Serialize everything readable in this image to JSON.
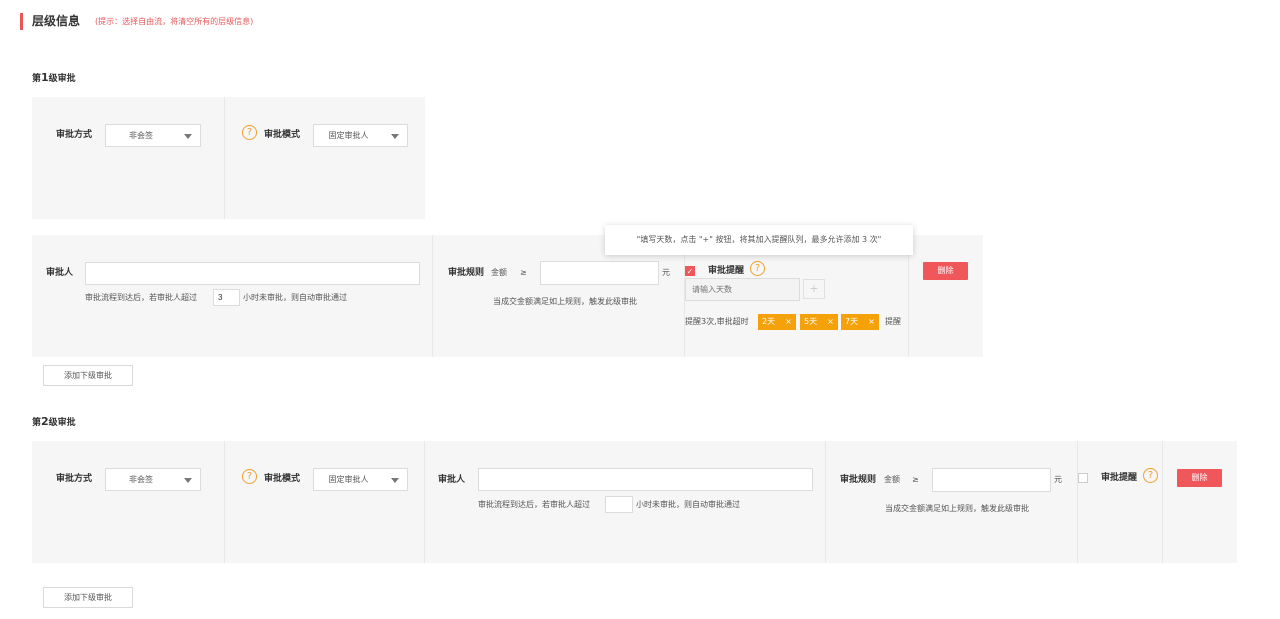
{
  "section": {
    "title": "层级信息",
    "hint": "(提示：选择自由流，将清空所有的层级信息)"
  },
  "level1": {
    "title_prefix": "第",
    "title_num": "1",
    "title_suffix": "级审批",
    "method_label": "审批方式",
    "method_value": "非会签",
    "mode_label": "审批模式",
    "mode_value": "固定审批人",
    "approver_label": "审批人",
    "approver_value": "",
    "timeout_prefix": "审批流程到达后，若审批人超过",
    "timeout_hours": "3",
    "timeout_suffix": "小时未审批，则自动审批通过",
    "rule_label": "审批规则",
    "amount_label": "金额",
    "gte": "≥",
    "amount_value": "",
    "unit": "元",
    "rule_desc": "当成交金额满足如上规则，触发此级审批",
    "remind_label": "审批提醒",
    "remind_checked": true,
    "days_placeholder": "请输入天数",
    "plus": "+",
    "remind_prefix": "提醒3次,审批超时",
    "tags": [
      "2天",
      "5天",
      "7天"
    ],
    "remind_suffix": "提醒",
    "tooltip": "\"填写天数，点击 \"+\" 按钮，将其加入提醒队列，最多允许添加 3 次\"",
    "delete": "删除",
    "add_next": "添加下级审批"
  },
  "level2": {
    "title_prefix": "第",
    "title_num": "2",
    "title_suffix": "级审批",
    "method_label": "审批方式",
    "method_value": "非会签",
    "mode_label": "审批模式",
    "mode_value": "固定审批人",
    "approver_label": "审批人",
    "approver_value": "",
    "timeout_prefix": "审批流程到达后，若审批人超过",
    "timeout_hours": "",
    "timeout_suffix": "小时未审批，则自动审批通过",
    "rule_label": "审批规则",
    "amount_label": "金额",
    "gte": "≥",
    "amount_value": "",
    "unit": "元",
    "rule_desc": "当成交金额满足如上规则，触发此级审批",
    "remind_label": "审批提醒",
    "remind_checked": false,
    "delete": "删除",
    "add_next": "添加下级审批"
  },
  "icons": {
    "help": "?",
    "close": "×",
    "check": "✓"
  },
  "colors": {
    "accent_red": "#f0575b",
    "tag_orange": "#f5a10a",
    "help_orange": "#f0a030",
    "panel_bg": "#f6f6f6"
  }
}
